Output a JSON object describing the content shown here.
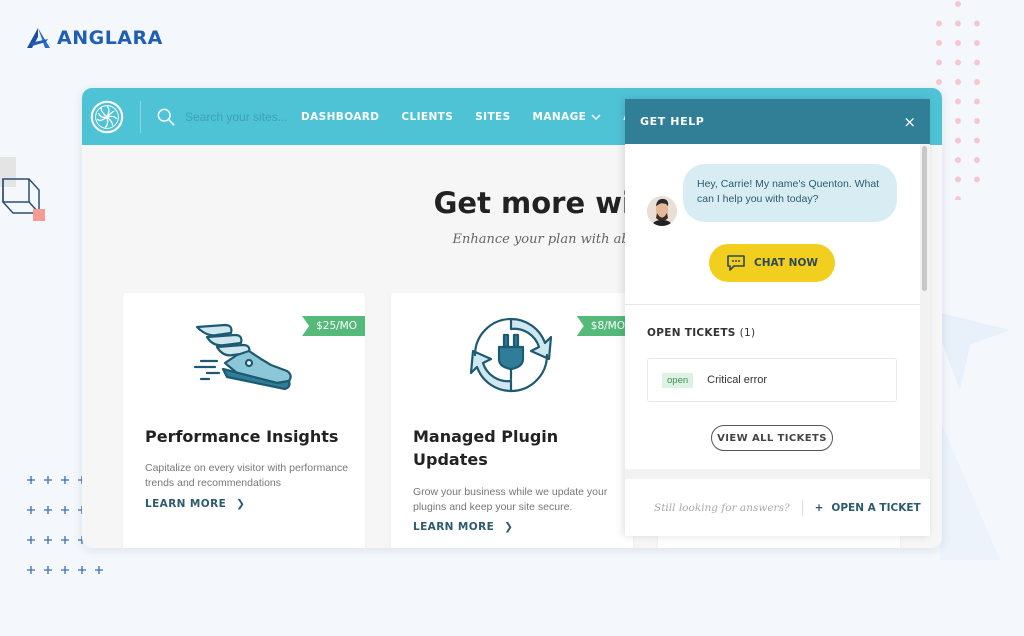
{
  "brand": {
    "name": "ANGLARA"
  },
  "topbar": {
    "search_placeholder": "Search your sites...",
    "nav": [
      {
        "label": "DASHBOARD"
      },
      {
        "label": "CLIENTS"
      },
      {
        "label": "SITES"
      },
      {
        "label": "MANAGE",
        "has_dropdown": true
      },
      {
        "label": "ADD-ONS"
      }
    ]
  },
  "hero": {
    "title": "Get more with Add-ons",
    "subtitle": "Enhance your plan with above-and-beyond services"
  },
  "cards": [
    {
      "icon": "winged-shoe-icon",
      "price": "$25/MO",
      "title": "Performance Insights",
      "description": "Capitalize on every visitor with performance trends and recommendations",
      "cta": "LEARN MORE"
    },
    {
      "icon": "plug-refresh-icon",
      "price": "$8/MO",
      "title": "Managed Plugin Updates",
      "description": "Grow your business while we update your plugins and keep your site secure.",
      "cta": "LEARN MORE"
    }
  ],
  "help": {
    "title": "GET HELP",
    "close": "×",
    "chat_message": "Hey, Carrie! My name's Quenton. What can I help you with today?",
    "chat_button": "CHAT NOW",
    "tickets_heading": "OPEN TICKETS",
    "tickets_count": "(1)",
    "tickets": [
      {
        "status": "open",
        "title": "Critical error"
      }
    ],
    "view_all": "VIEW ALL TICKETS",
    "footer_text": "Still looking for answers?",
    "open_ticket": "OPEN A TICKET",
    "open_ticket_icon": "+"
  },
  "colors": {
    "topbar": "#4fc3d6",
    "help_header": "#317f96",
    "chat_button": "#f2cf1f",
    "price_tag": "#55b97a",
    "brand": "#1f5fb5"
  }
}
